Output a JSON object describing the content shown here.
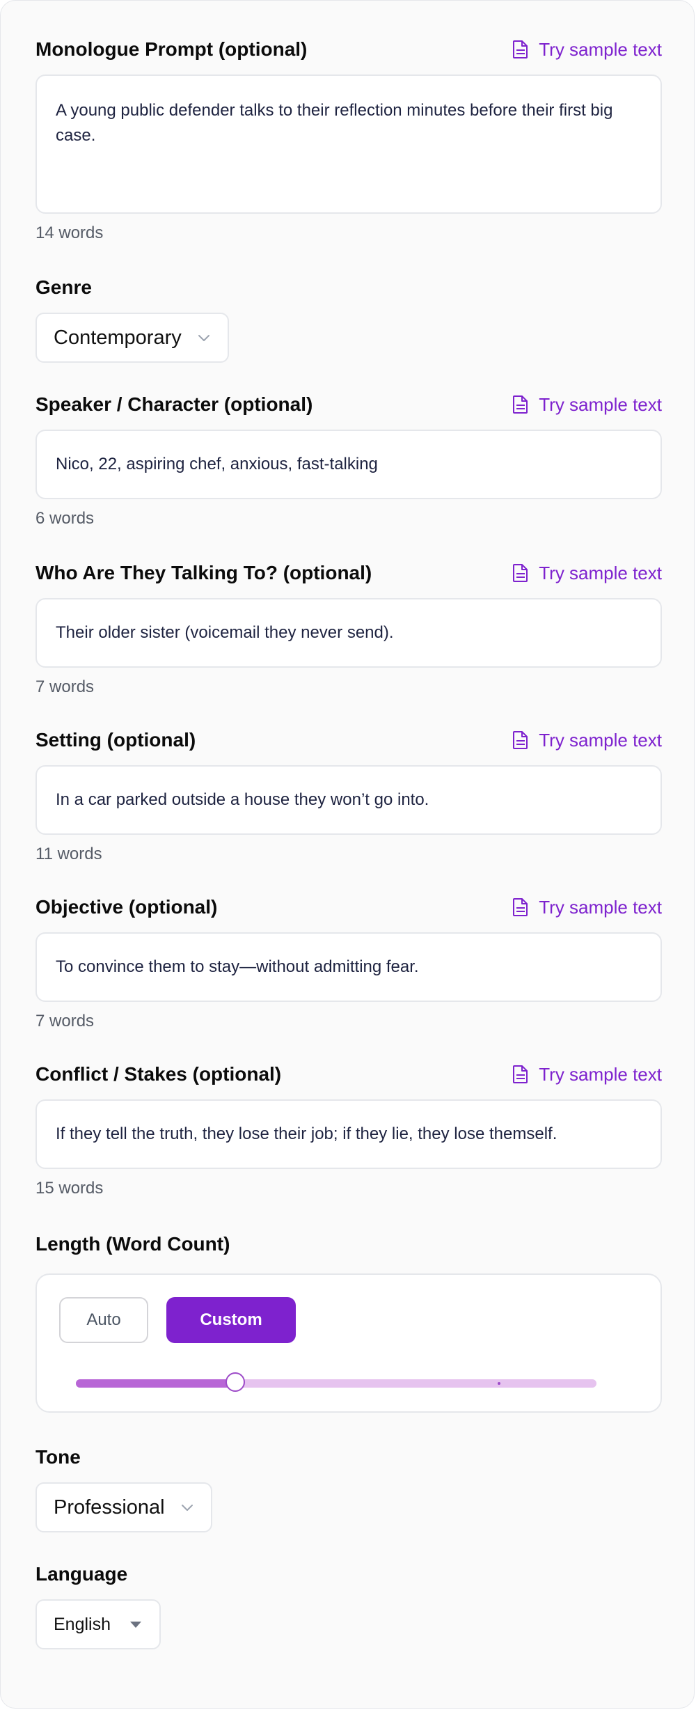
{
  "sample_link_label": "Try sample text",
  "accent_color": "#7e22ce",
  "prompt": {
    "label": "Monologue Prompt (optional)",
    "value": "A young public defender talks to their reflection minutes before their first big case.",
    "word_count": "14 words"
  },
  "genre": {
    "label": "Genre",
    "selected": "Contemporary"
  },
  "speaker": {
    "label": "Speaker / Character (optional)",
    "value": "Nico, 22, aspiring chef, anxious, fast-talking",
    "word_count": "6 words"
  },
  "audience": {
    "label": "Who Are They Talking To? (optional)",
    "value": "Their older sister (voicemail they never send).",
    "word_count": "7 words"
  },
  "setting": {
    "label": "Setting (optional)",
    "value": "In a car parked outside a house they won’t go into.",
    "word_count": "11 words"
  },
  "objective": {
    "label": "Objective (optional)",
    "value": "To convince them to stay—without admitting fear.",
    "word_count": "7 words"
  },
  "conflict": {
    "label": "Conflict / Stakes (optional)",
    "value": "If they tell the truth, they lose their job; if they lie, they lose themself.",
    "word_count": "15 words"
  },
  "length": {
    "label": "Length (Word Count)",
    "auto_label": "Auto",
    "custom_label": "Custom",
    "mode": "Custom",
    "slider_fraction": 0.306
  },
  "tone": {
    "label": "Tone",
    "selected": "Professional"
  },
  "language": {
    "label": "Language",
    "selected": "English"
  }
}
